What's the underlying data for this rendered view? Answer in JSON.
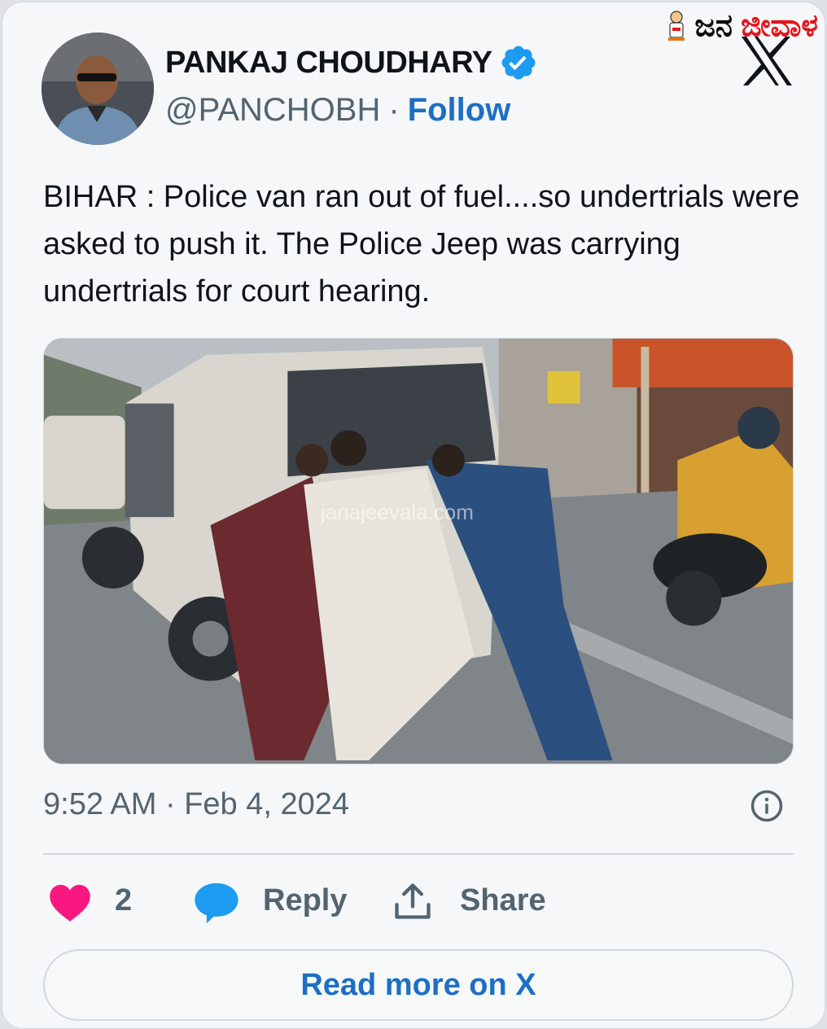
{
  "brand": {
    "name_black": "ಜನ",
    "name_red": "ಜೀವಾಳ"
  },
  "author": {
    "name": "PANKAJ CHOUDHARY",
    "handle": "@PANCHOBH",
    "separator": "·",
    "follow_label": "Follow",
    "verified": true
  },
  "tweet": {
    "text": "BIHAR : Police van ran out of fuel....so undertrials were asked to push it. The Police Jeep was carrying undertrials for court hearing.",
    "media_watermark": "janajeevala.com",
    "timestamp": "9:52 AM · Feb 4, 2024"
  },
  "actions": {
    "like_count": "2",
    "reply_label": "Reply",
    "share_label": "Share"
  },
  "footer": {
    "read_more_label": "Read more on X"
  },
  "colors": {
    "accent": "#1d6fc4",
    "verified": "#1d9bf0",
    "heart": "#f91880",
    "reply_bubble": "#1d9bf0",
    "brand_red": "#e3141b",
    "text": "#0f1419",
    "muted": "#536471"
  },
  "icons": [
    "verified-badge-icon",
    "x-logo-icon",
    "info-icon",
    "heart-icon",
    "reply-bubble-icon",
    "share-icon",
    "mascot-icon"
  ]
}
